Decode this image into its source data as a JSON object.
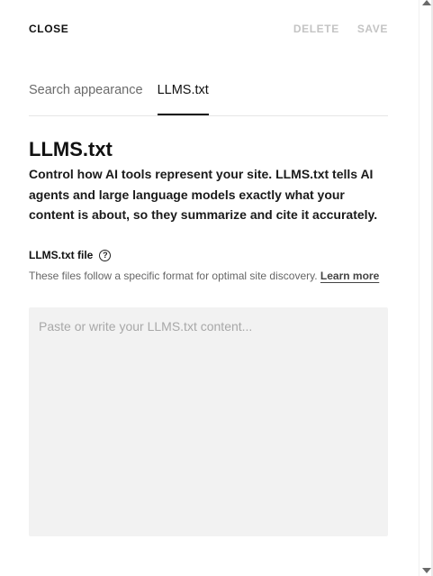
{
  "header": {
    "close_label": "CLOSE",
    "delete_label": "DELETE",
    "save_label": "SAVE"
  },
  "tabs": [
    {
      "label": "Search appearance",
      "active": false
    },
    {
      "label": "LLMS.txt",
      "active": true
    }
  ],
  "section": {
    "title": "LLMS.txt",
    "description": "Control how AI tools represent your site. LLMS.txt tells AI agents and large language models exactly what your content is about, so they summarize and cite it accurately."
  },
  "field": {
    "label": "LLMS.txt file",
    "help_icon": "question-circle-icon",
    "helper_text": "These files follow a specific format for optimal site discovery. ",
    "learn_more": "Learn more",
    "placeholder": "Paste or write your LLMS.txt content...",
    "value": ""
  },
  "colors": {
    "disabled_action": "#c4c4c4",
    "textarea_bg": "#f2f2f2",
    "active_tab_underline": "#111111"
  }
}
